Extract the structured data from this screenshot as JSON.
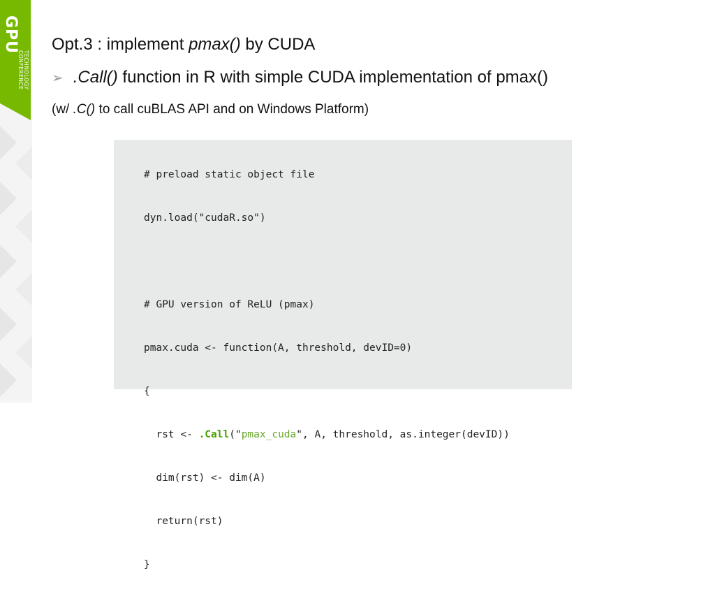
{
  "badge": {
    "gpu": "GPU",
    "conference_lines": [
      "TECHNOLOGY",
      "CONFERENCE"
    ]
  },
  "title": {
    "prefix": "Opt.3 : implement ",
    "func": "pmax()",
    "suffix": " by CUDA"
  },
  "bullet": {
    "arrow": "➢",
    "func": ".Call()",
    "rest": " function in R with simple CUDA implementation of pmax()"
  },
  "note": {
    "prefix": "(w/ ",
    "func": ".C()",
    "suffix": " to call cuBLAS API and on Windows Platform)"
  },
  "code": {
    "line1": "# preload static object file",
    "line2": "dyn.load(\"cudaR.so\")",
    "line3": "",
    "line4": "# GPU version of ReLU (pmax)",
    "line5": "pmax.cuda <- function(A, threshold, devID=0)",
    "line6": "{",
    "line7_a": "  rst <- ",
    "line7_kw": ".Call",
    "line7_b": "(\"",
    "line7_str": "pmax_cuda",
    "line7_c": "\", A, threshold, as.integer(devID))",
    "line8": "  dim(rst) <- dim(A)",
    "line9": "  return(rst)",
    "line10": "}"
  }
}
